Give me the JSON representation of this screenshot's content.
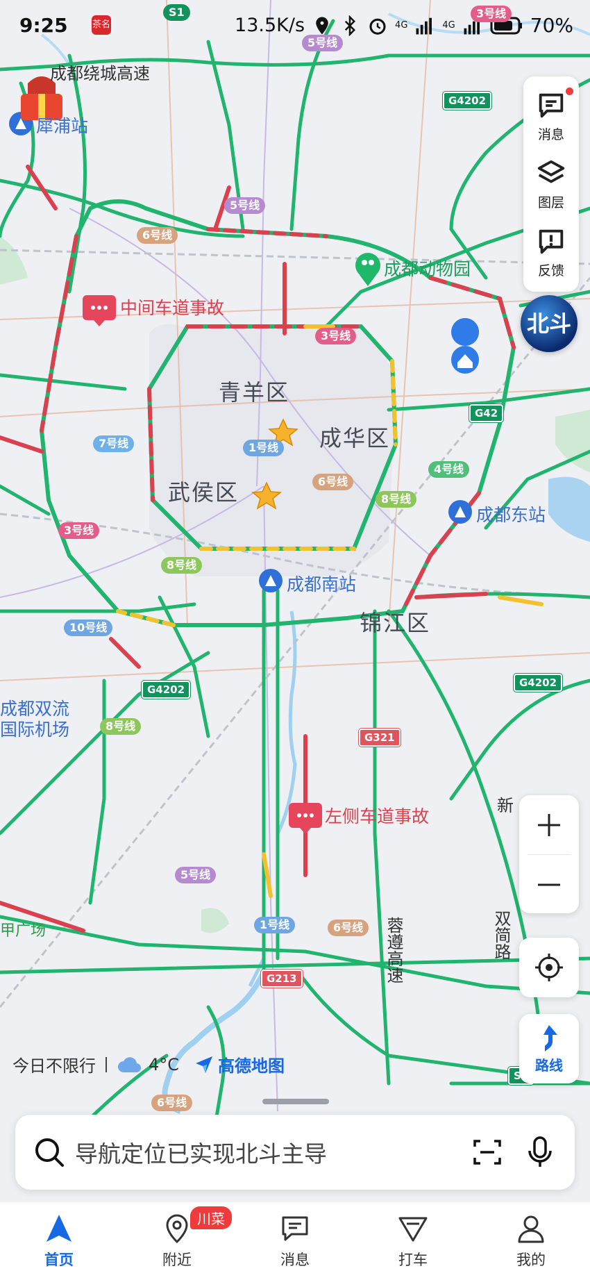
{
  "status_bar": {
    "time": "9:25",
    "app_badge": "茶名",
    "net_speed": "13.5K/s",
    "network1": "4G",
    "network2": "4G",
    "battery": "70%"
  },
  "map": {
    "districts": [
      "青羊区",
      "成华区",
      "武侯区",
      "锦江区"
    ],
    "stations": {
      "pixian": "犀浦站",
      "south": "成都南站",
      "east": "成都东站"
    },
    "airport": "成都双流\n国际机场",
    "poi_zoo": "成都动物园",
    "incidents": {
      "middle_lane": "中间车道事故",
      "left_lane": "左侧车道事故"
    },
    "roads": {
      "ring": "成都绕城高速",
      "rongzun": "蓉遵高速",
      "shuangjian": "双简路",
      "new": "新",
      "plaza": "甲广场"
    },
    "metro": [
      "S1",
      "5号线",
      "5号线",
      "6号线",
      "3号线",
      "7号线",
      "1号线",
      "6号线",
      "8号线",
      "4号线",
      "3号线",
      "8号线",
      "10号线",
      "8号线",
      "5号线",
      "1号线",
      "6号线",
      "6号线",
      "3号线"
    ],
    "highways": [
      "G4202",
      "G42",
      "G4202",
      "G4202",
      "G321",
      "G213",
      "S4"
    ]
  },
  "side_panel": {
    "messages": "消息",
    "layers": "图层",
    "feedback": "反馈"
  },
  "beidou_label": "北斗",
  "bottom_info": {
    "restriction": "今日不限行",
    "temperature": "4°C",
    "brand": "高德地图"
  },
  "route_label": "路线",
  "search": {
    "placeholder": "导航定位已实现北斗主导"
  },
  "tabs": [
    {
      "label": "首页",
      "active": true
    },
    {
      "label": "附近",
      "badge": "川菜"
    },
    {
      "label": "消息"
    },
    {
      "label": "打车"
    },
    {
      "label": "我的"
    }
  ],
  "colors": {
    "accent": "#1668e3",
    "road_green": "#20b46e",
    "road_red": "#d9414e",
    "road_yellow": "#f2c12e"
  }
}
